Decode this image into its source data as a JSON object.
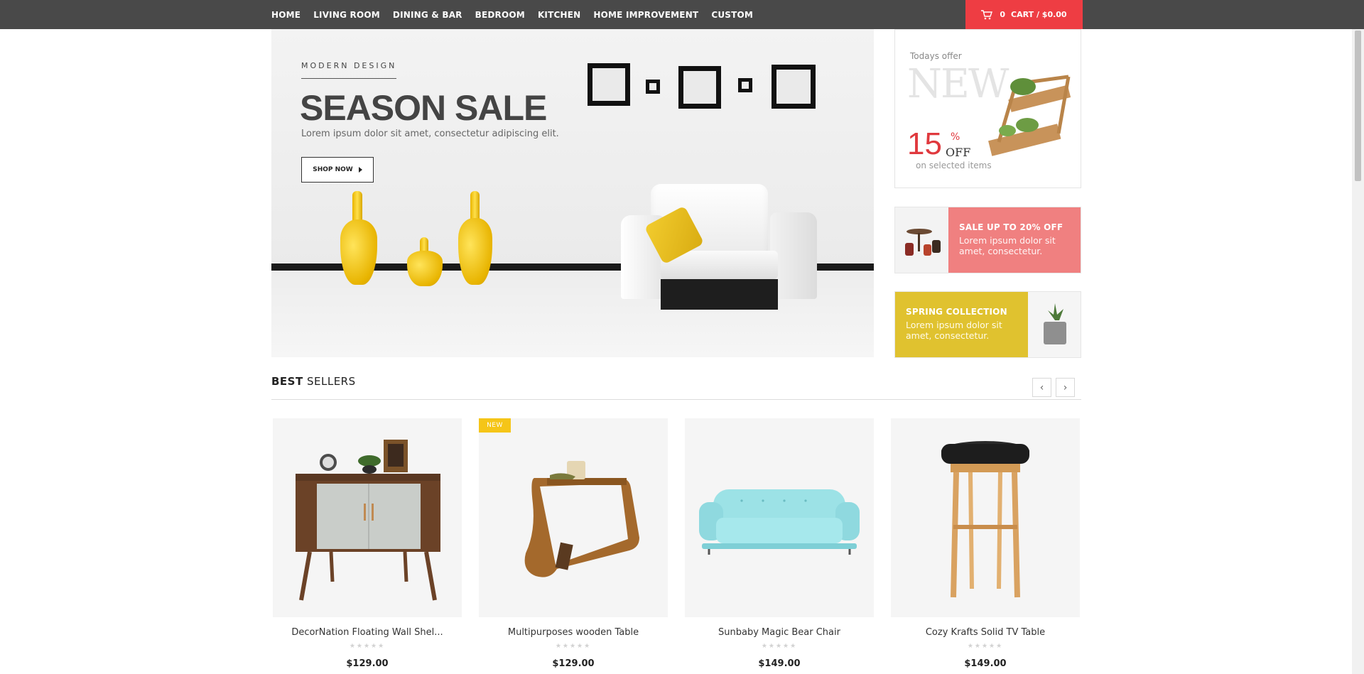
{
  "nav": {
    "items": [
      "HOME",
      "LIVING ROOM",
      "DINING & BAR",
      "BEDROOM",
      "KITCHEN",
      "HOME IMPROVEMENT",
      "CUSTOM"
    ]
  },
  "cart": {
    "count": "0",
    "label": "CART / $0.00"
  },
  "hero": {
    "eyebrow": "MODERN DESIGN",
    "title": "SEASON SALE",
    "subtitle": "Lorem ipsum dolor sit amet, consectetur adipiscing elit.",
    "button": "SHOP NOW"
  },
  "offer": {
    "todays": "Todays offer",
    "new_word": "NEW",
    "percent": "15",
    "percent_sign": "%",
    "off": "OFF",
    "selected": "on selected items"
  },
  "sale_card": {
    "head": "SALE UP TO 20% OFF",
    "body": "Lorem ipsum dolor sit amet, consectetur."
  },
  "spring_card": {
    "head": "SPRING COLLECTION",
    "body": "Lorem ipsum dolor sit amet, consectetur."
  },
  "best_sellers": {
    "title_bold": "BEST",
    "title_rest": " SELLERS",
    "prev": "‹",
    "next": "›",
    "products": [
      {
        "name": "DecorNation Floating Wall Shel...",
        "stars": "★★★★★",
        "price": "$129.00",
        "badge": ""
      },
      {
        "name": "Multipurposes wooden Table",
        "stars": "★★★★★",
        "price": "$129.00",
        "badge": "NEW"
      },
      {
        "name": "Sunbaby Magic Bear Chair",
        "stars": "★★★★★",
        "price": "$149.00",
        "badge": ""
      },
      {
        "name": "Cozy Krafts Solid TV Table",
        "stars": "★★★★★",
        "price": "$149.00",
        "badge": ""
      }
    ]
  },
  "colors": {
    "nav_bg": "#494949",
    "cart_bg": "#ee3d43",
    "sale_bg": "#f08080",
    "spring_bg": "#e0c22f",
    "badge": "#f5c518"
  }
}
